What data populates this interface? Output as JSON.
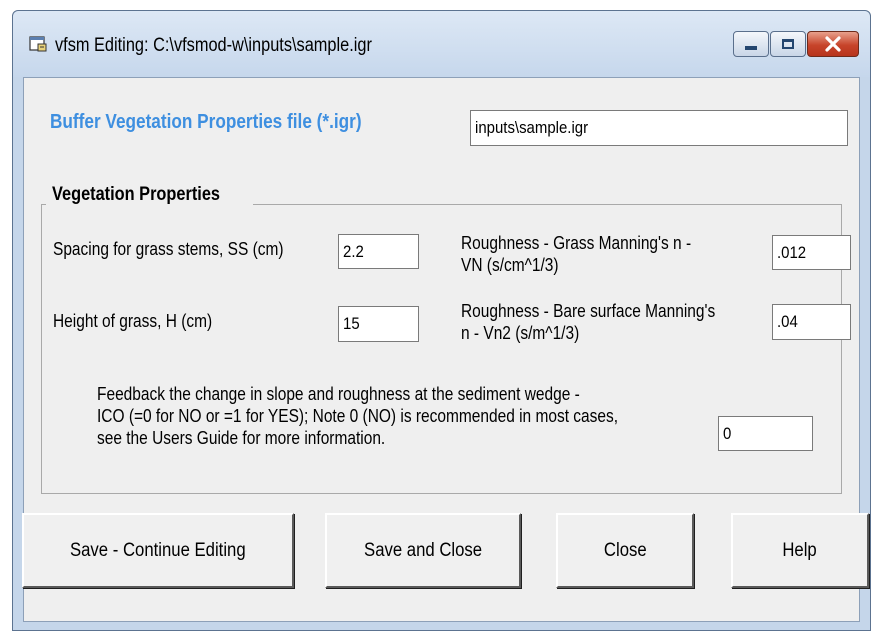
{
  "window": {
    "title": "vfsm Editing: C:\\vfsmod-w\\inputs\\sample.igr",
    "icon": "app-icon",
    "controls": [
      "minimize-icon",
      "maximize-icon",
      "close-icon"
    ]
  },
  "file": {
    "label": "Buffer Vegetation Properties file (*.igr)",
    "value": "inputs\\sample.igr",
    "label_color": "#3e8fe0"
  },
  "vegetation": {
    "group_title": "Vegetation Properties",
    "spacing": {
      "label": "Spacing for grass stems, SS (cm)",
      "value": "2.2"
    },
    "height": {
      "label": "Height of grass, H (cm)",
      "value": "15"
    },
    "roughness_grass": {
      "label_line1": "Roughness - Grass Manning's n -",
      "label_line2": "VN (s/cm^1/3)",
      "value": ".012"
    },
    "roughness_bare": {
      "label_line1": "Roughness - Bare surface Manning's",
      "label_line2": "n - Vn2 (s/m^1/3)",
      "value": ".04"
    },
    "feedback": {
      "line1": "Feedback the change in slope and roughness at the sediment wedge -",
      "line2": "ICO (=0 for NO or =1 for YES); Note 0 (NO) is recommended in most cases,",
      "line3": "see the Users Guide for more information.",
      "value": "0"
    }
  },
  "buttons": {
    "save_continue": "Save - Continue Editing",
    "save_close": "Save and Close",
    "close": "Close",
    "help": "Help"
  }
}
